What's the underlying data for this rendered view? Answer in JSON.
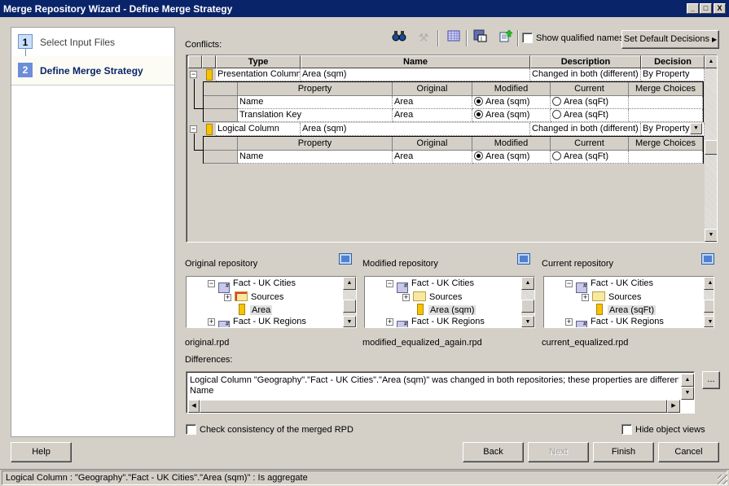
{
  "window": {
    "title": "Merge Repository Wizard - Define Merge Strategy",
    "controls": [
      "_",
      "□",
      "X"
    ]
  },
  "steps": [
    {
      "number": "1",
      "label": "Select Input Files",
      "active": false
    },
    {
      "number": "2",
      "label": "Define Merge Strategy",
      "active": true
    }
  ],
  "conflicts": {
    "label": "Conflicts:",
    "toolbar": {
      "icons": [
        "binoculars-icon",
        "wand-icon",
        "grid-icon",
        "save-icon",
        "export-icon"
      ],
      "show_qualified_names_label": "Show qualified names",
      "show_qualified_names_checked": false,
      "set_default_decisions_label": "Set Default Decisions"
    },
    "columns": [
      "Type",
      "Name",
      "Description",
      "Decision"
    ],
    "sub_columns": [
      "Property",
      "Original",
      "Modified",
      "Current",
      "Merge Choices"
    ],
    "rows": [
      {
        "type": "Presentation Column",
        "name": "Area (sqm)",
        "description": "Changed in both (different)",
        "decision": "By Property",
        "properties": [
          {
            "property": "Name",
            "original": "Area",
            "modified": "Area (sqm)",
            "current": "Area (sqFt)",
            "merge_choices": ""
          },
          {
            "property": "Translation Key",
            "original": "Area",
            "modified": "Area (sqm)",
            "current": "Area (sqFt)",
            "merge_choices": ""
          }
        ]
      },
      {
        "type": "Logical Column",
        "name": "Area (sqm)",
        "description": "Changed in both (different)",
        "decision": "By Property",
        "properties": [
          {
            "property": "Name",
            "original": "Area",
            "modified": "Area (sqm)",
            "current": "Area (sqFt)",
            "merge_choices": ""
          }
        ]
      }
    ]
  },
  "repositories": [
    {
      "label": "Original repository",
      "file": "original.rpd",
      "tree": [
        {
          "label": "Fact - UK Cities",
          "expander": "-"
        },
        {
          "label": "Sources",
          "expander": "+"
        },
        {
          "label": "Area",
          "selected": true
        },
        {
          "label": "Fact - UK Regions",
          "expander": "+"
        }
      ]
    },
    {
      "label": "Modified repository",
      "file": "modified_equalized_again.rpd",
      "tree": [
        {
          "label": "Fact - UK Cities",
          "expander": "-"
        },
        {
          "label": "Sources",
          "expander": "+"
        },
        {
          "label": "Area (sqm)",
          "selected": true
        },
        {
          "label": "Fact - UK Regions",
          "expander": "+"
        }
      ]
    },
    {
      "label": "Current repository",
      "file": "current_equalized.rpd",
      "tree": [
        {
          "label": "Fact - UK Cities",
          "expander": "-"
        },
        {
          "label": "Sources",
          "expander": "+"
        },
        {
          "label": "Area (sqFt)",
          "selected": true
        },
        {
          "label": "Fact - UK Regions",
          "expander": "+"
        }
      ]
    }
  ],
  "differences": {
    "label": "Differences:",
    "line1": "Logical Column \"Geography\".\"Fact - UK Cities\".\"Area (sqm)\" was changed in both repositories; these properties are different:",
    "line2": "Name",
    "ellipsis_label": "..."
  },
  "options": {
    "check_consistency_label": "Check consistency of the merged RPD",
    "check_consistency_checked": false,
    "hide_object_views_label": "Hide object views",
    "hide_object_views_checked": false
  },
  "buttons": {
    "help": "Help",
    "back": "Back",
    "next": "Next",
    "finish": "Finish",
    "cancel": "Cancel"
  },
  "status": "Logical Column : \"Geography\".\"Fact - UK Cities\".\"Area (sqm)\" : Is aggregate"
}
